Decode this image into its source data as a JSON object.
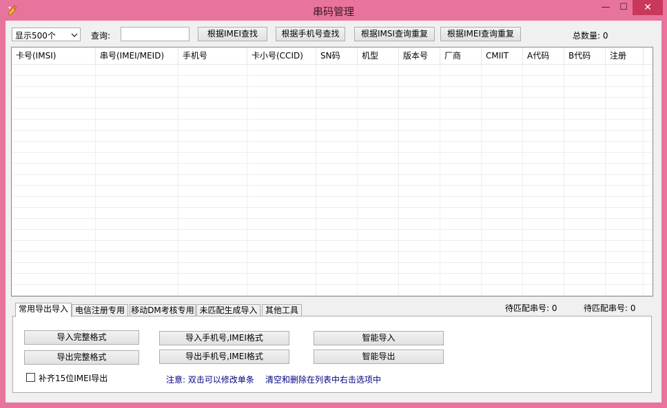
{
  "window": {
    "title": "串码管理",
    "min_glyph": "—",
    "max_glyph": "☐",
    "close_glyph": "✕"
  },
  "toolbar": {
    "display_select": "显示500个",
    "query_label": "查询:",
    "query_value": "",
    "btn_find_imei": "根据IMEI查找",
    "btn_find_phone": "根据手机号查找",
    "btn_imsi_dup": "根据IMSI查询重复",
    "btn_imei_dup": "根据IMEI查询重复",
    "total_count": "总数量: 0"
  },
  "table": {
    "columns": [
      "卡号(IMSI)",
      "串号(IMEI/MEID)",
      "手机号",
      "卡小号(CCID)",
      "SN码",
      "机型",
      "版本号",
      "厂商",
      "CMIIT",
      "A代码",
      "B代码",
      "注册"
    ]
  },
  "status": {
    "pending1": "待匹配串号: 0",
    "pending2": "待匹配串号: 0"
  },
  "tabs": [
    "常用导出导入",
    "电信注册专用",
    "移动DM考核专用",
    "未匹配生成导入",
    "其他工具"
  ],
  "panel": {
    "btn_import_full": "导入完整格式",
    "btn_export_full": "导出完整格式",
    "btn_import_phone_imei": "导入手机号,IMEI格式",
    "btn_export_phone_imei": "导出手机号,IMEI格式",
    "btn_smart_import": "智能导入",
    "btn_smart_export": "智能导出",
    "checkbox_label": "补齐15位IMEI导出",
    "note1": "注意: 双击可以修改单条",
    "note2": "清空和删除在列表中右击选项中"
  },
  "colors": {
    "frame": "#e8739c",
    "close_button": "#c7385a",
    "note_text": "#000080"
  }
}
